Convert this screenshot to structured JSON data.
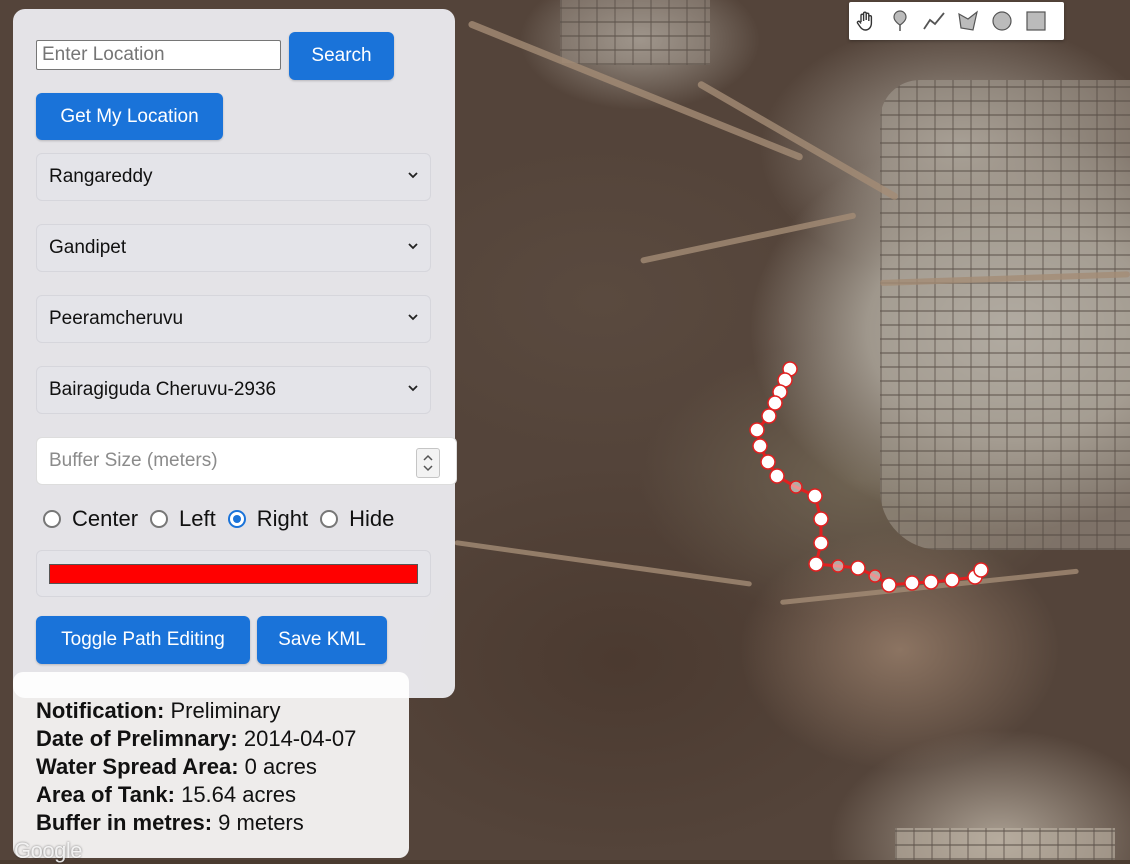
{
  "search": {
    "placeholder": "Enter Location",
    "value": "",
    "button_label": "Search"
  },
  "get_location_label": "Get My Location",
  "selects": {
    "district": "Rangareddy",
    "mandal": "Gandipet",
    "village": "Peeramcheruvu",
    "tank": "Bairagiguda Cheruvu-2936"
  },
  "buffer": {
    "placeholder": "Buffer Size (meters)",
    "value": ""
  },
  "position_options": {
    "center": "Center",
    "left": "Left",
    "right": "Right",
    "hide": "Hide",
    "selected": "Right"
  },
  "path_color": "#ff0000",
  "buttons": {
    "toggle_editing": "Toggle Path Editing",
    "save_kml": "Save KML"
  },
  "info": {
    "notification": {
      "label": "Notification:",
      "value": "Preliminary"
    },
    "date": {
      "label": "Date of Prelimnary:",
      "value": "2014-04-07"
    },
    "water_spread": {
      "label": "Water Spread Area:",
      "value": "0 acres"
    },
    "tank_area": {
      "label": "Area of Tank:",
      "value": "15.64 acres"
    },
    "buffer": {
      "label": "Buffer in metres:",
      "value": "9 meters"
    }
  },
  "toolbar": [
    "hand-icon",
    "marker-icon",
    "polyline-icon",
    "polygon-icon",
    "circle-icon",
    "rectangle-icon"
  ],
  "map_attribution": "Google"
}
